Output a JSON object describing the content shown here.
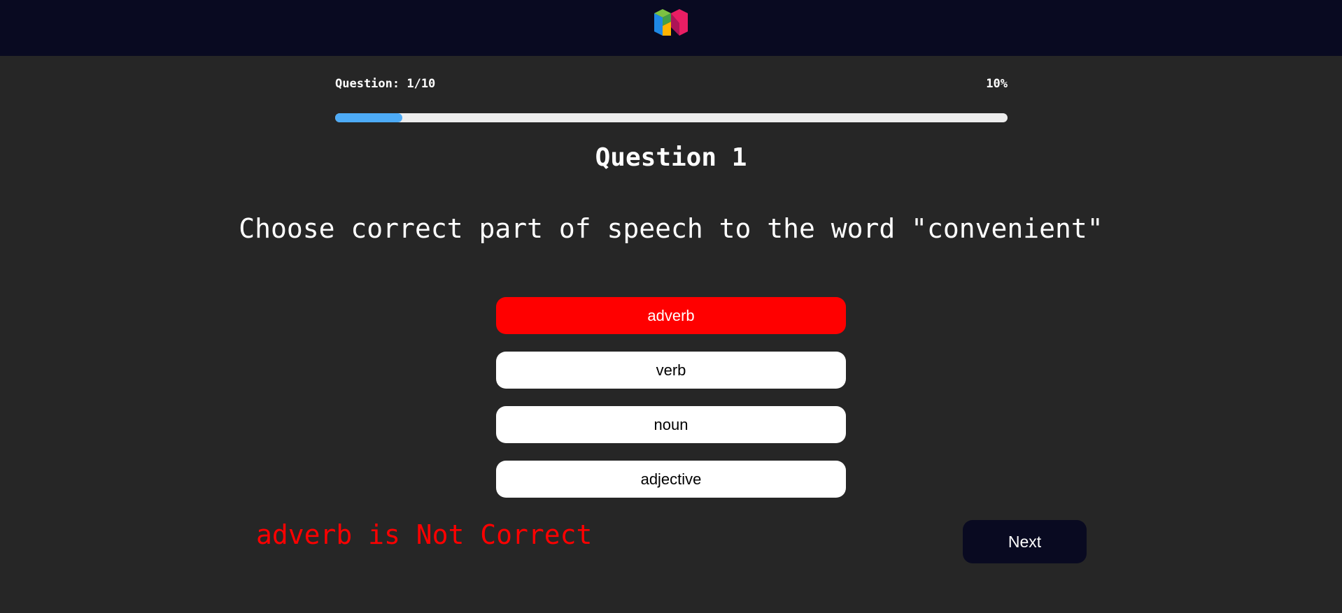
{
  "header": {
    "logo": "brand-logo"
  },
  "progress": {
    "label": "Question: 1/10",
    "percent_label": "10%",
    "fraction": 0.1,
    "bar_color": "#4dabf7"
  },
  "question": {
    "title": "Question 1",
    "text": "Choose correct part of speech to the word \"convenient\""
  },
  "answers": [
    {
      "label": "adverb",
      "state": "wrong"
    },
    {
      "label": "verb",
      "state": "default"
    },
    {
      "label": "noun",
      "state": "default"
    },
    {
      "label": "adjective",
      "state": "default"
    }
  ],
  "feedback": {
    "text": "adverb is Not Correct",
    "color": "#ff0000"
  },
  "actions": {
    "next_label": "Next"
  },
  "colors": {
    "header_bg": "#090a21",
    "page_bg": "#262626",
    "wrong": "#ff0000"
  }
}
